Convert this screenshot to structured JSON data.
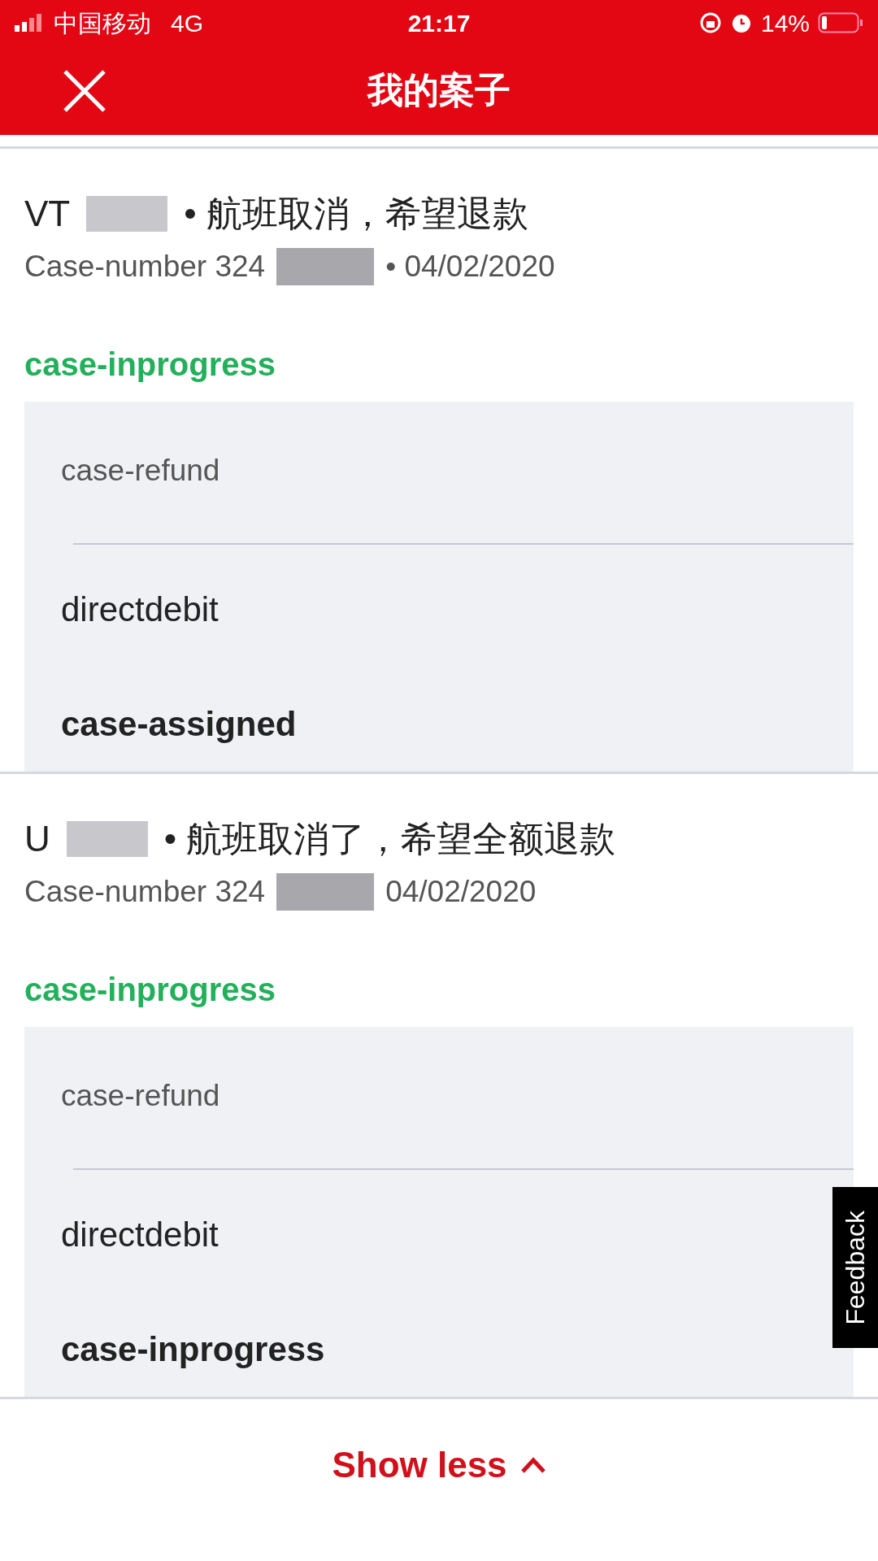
{
  "status_bar": {
    "carrier": "中国移动",
    "network": "4G",
    "time": "21:17",
    "battery": "14%"
  },
  "header": {
    "title": "我的案子"
  },
  "cases": [
    {
      "code": "VT",
      "title": "• 航班取消，希望退款",
      "case_number": "Case-number 324",
      "date": "• 04/02/2020",
      "status": "case-inprogress",
      "detail": {
        "type": "case-refund",
        "method": "directdebit",
        "state": "case-assigned"
      }
    },
    {
      "code": "U",
      "title": "• 航班取消了，希望全额退款",
      "case_number": "Case-number 324",
      "date": "04/02/2020",
      "status": "case-inprogress",
      "detail": {
        "type": "case-refund",
        "method": "directdebit",
        "state": "case-inprogress"
      }
    }
  ],
  "show_less": "Show less",
  "feedback": "Feedback"
}
